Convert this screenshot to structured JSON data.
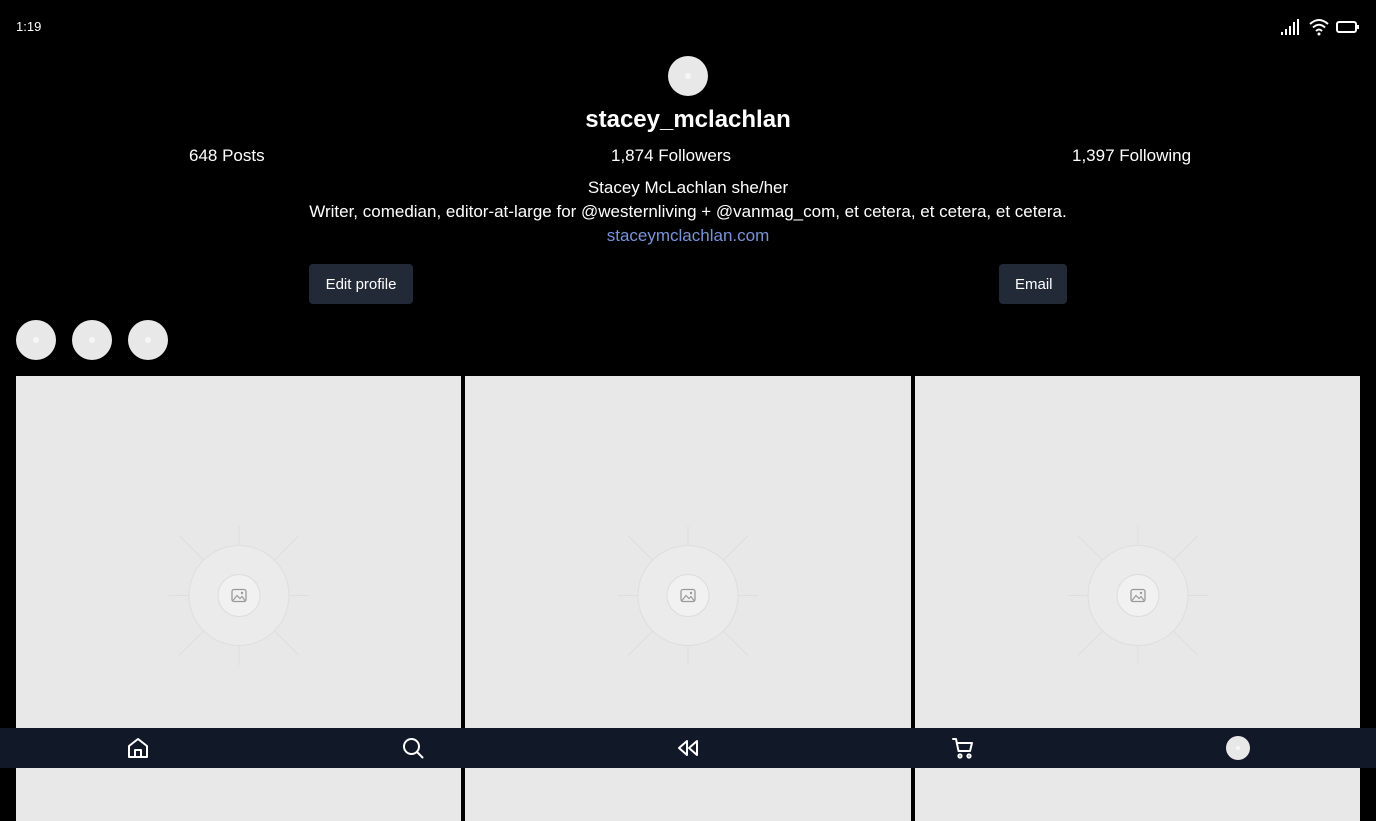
{
  "status_bar": {
    "time": "1:19",
    "icons": [
      "signal-icon",
      "wifi-icon",
      "battery-icon"
    ]
  },
  "profile": {
    "username": "stacey_mclachlan",
    "stats": {
      "posts": "648 Posts",
      "followers": "1,874 Followers",
      "following": "1,397 Following"
    },
    "bio": {
      "name_line": "Stacey McLachlan she/her",
      "description": "Writer, comedian, editor-at-large for @westernliving + @vanmag_com, et cetera, et cetera, et cetera.",
      "link": "staceymclachlan.com"
    },
    "actions": {
      "edit_profile": "Edit profile",
      "email": "Email"
    }
  },
  "highlights_count": 3,
  "posts_grid": {
    "columns": 3,
    "placeholder_icon": "image-placeholder-icon"
  },
  "bottom_nav": {
    "items": [
      "home-icon",
      "search-icon",
      "reels-rewind-icon",
      "shopping-cart-icon",
      "profile-avatar"
    ]
  },
  "colors": {
    "background": "#000000",
    "button_bg": "#222a37",
    "link": "#7a93d8",
    "nav_bg": "#111827",
    "placeholder": "#e8e8e8"
  }
}
